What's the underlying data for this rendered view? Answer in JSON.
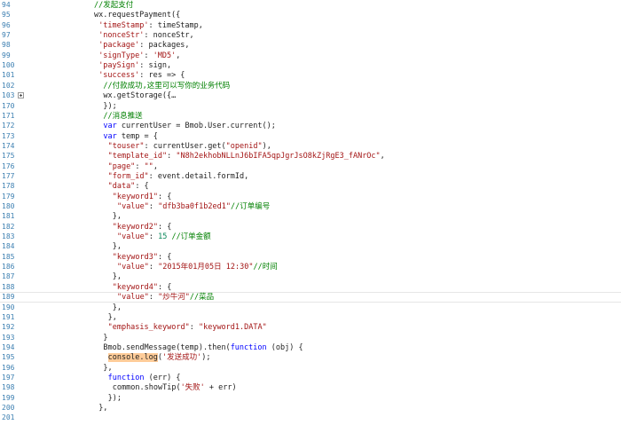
{
  "editor": {
    "lines": [
      {
        "n": "94",
        "indent": 10,
        "tokens": [
          {
            "t": "//发起支付",
            "c": "cm"
          }
        ]
      },
      {
        "n": "95",
        "indent": 10,
        "tokens": [
          {
            "t": "wx.requestPayment({",
            "c": "pl"
          }
        ]
      },
      {
        "n": "96",
        "indent": 12,
        "tokens": [
          {
            "t": "'timeStamp'",
            "c": "str"
          },
          {
            "t": ": timeStamp,",
            "c": "pl"
          }
        ]
      },
      {
        "n": "97",
        "indent": 12,
        "tokens": [
          {
            "t": "'nonceStr'",
            "c": "str"
          },
          {
            "t": ": nonceStr,",
            "c": "pl"
          }
        ]
      },
      {
        "n": "98",
        "indent": 12,
        "tokens": [
          {
            "t": "'package'",
            "c": "str"
          },
          {
            "t": ": packages,",
            "c": "pl"
          }
        ]
      },
      {
        "n": "99",
        "indent": 12,
        "tokens": [
          {
            "t": "'signType'",
            "c": "str"
          },
          {
            "t": ": ",
            "c": "pl"
          },
          {
            "t": "'MD5'",
            "c": "str"
          },
          {
            "t": ",",
            "c": "pl"
          }
        ]
      },
      {
        "n": "100",
        "indent": 12,
        "tokens": [
          {
            "t": "'paySign'",
            "c": "str"
          },
          {
            "t": ": sign,",
            "c": "pl"
          }
        ]
      },
      {
        "n": "101",
        "indent": 12,
        "tokens": [
          {
            "t": "'success'",
            "c": "str"
          },
          {
            "t": ": res => {",
            "c": "pl"
          }
        ]
      },
      {
        "n": "102",
        "indent": 14,
        "tokens": [
          {
            "t": "//付款成功,这里可以写你的业务代码",
            "c": "cm"
          }
        ]
      },
      {
        "n": "103",
        "indent": 14,
        "fold": true,
        "tokens": [
          {
            "t": "wx.getStorage({…",
            "c": "pl"
          }
        ]
      },
      {
        "n": "170",
        "indent": 14,
        "tokens": [
          {
            "t": "});",
            "c": "pl"
          }
        ]
      },
      {
        "n": "171",
        "indent": 14,
        "tokens": [
          {
            "t": "//消息推送",
            "c": "cm"
          }
        ]
      },
      {
        "n": "172",
        "indent": 14,
        "tokens": [
          {
            "t": "var",
            "c": "kw"
          },
          {
            "t": " currentUser = Bmob.User.current();",
            "c": "pl"
          }
        ]
      },
      {
        "n": "173",
        "indent": 14,
        "tokens": [
          {
            "t": "var",
            "c": "kw"
          },
          {
            "t": " temp = {",
            "c": "pl"
          }
        ]
      },
      {
        "n": "174",
        "indent": 16,
        "tokens": [
          {
            "t": "\"touser\"",
            "c": "str"
          },
          {
            "t": ": currentUser.get(",
            "c": "pl"
          },
          {
            "t": "\"openid\"",
            "c": "str"
          },
          {
            "t": "),",
            "c": "pl"
          }
        ]
      },
      {
        "n": "175",
        "indent": 16,
        "tokens": [
          {
            "t": "\"template_id\"",
            "c": "str"
          },
          {
            "t": ": ",
            "c": "pl"
          },
          {
            "t": "\"N8h2ekhobNLLnJ6bIFA5qpJgrJsO8kZjRgE3_fANrOc\"",
            "c": "str"
          },
          {
            "t": ",",
            "c": "pl"
          }
        ]
      },
      {
        "n": "176",
        "indent": 16,
        "tokens": [
          {
            "t": "\"page\"",
            "c": "str"
          },
          {
            "t": ": ",
            "c": "pl"
          },
          {
            "t": "\"\"",
            "c": "str"
          },
          {
            "t": ",",
            "c": "pl"
          }
        ]
      },
      {
        "n": "177",
        "indent": 16,
        "tokens": [
          {
            "t": "\"form_id\"",
            "c": "str"
          },
          {
            "t": ": event.detail.formId,",
            "c": "pl"
          }
        ]
      },
      {
        "n": "178",
        "indent": 16,
        "tokens": [
          {
            "t": "\"data\"",
            "c": "str"
          },
          {
            "t": ": {",
            "c": "pl"
          }
        ]
      },
      {
        "n": "179",
        "indent": 18,
        "tokens": [
          {
            "t": "\"keyword1\"",
            "c": "str"
          },
          {
            "t": ": {",
            "c": "pl"
          }
        ]
      },
      {
        "n": "180",
        "indent": 20,
        "tokens": [
          {
            "t": "\"value\"",
            "c": "str"
          },
          {
            "t": ": ",
            "c": "pl"
          },
          {
            "t": "\"dfb3ba0f1b2ed1\"",
            "c": "str"
          },
          {
            "t": "//订单编号",
            "c": "cm"
          }
        ]
      },
      {
        "n": "181",
        "indent": 18,
        "tokens": [
          {
            "t": "},",
            "c": "pl"
          }
        ]
      },
      {
        "n": "182",
        "indent": 18,
        "tokens": [
          {
            "t": "\"keyword2\"",
            "c": "str"
          },
          {
            "t": ": {",
            "c": "pl"
          }
        ]
      },
      {
        "n": "183",
        "indent": 20,
        "tokens": [
          {
            "t": "\"value\"",
            "c": "str"
          },
          {
            "t": ": ",
            "c": "pl"
          },
          {
            "t": "15",
            "c": "num"
          },
          {
            "t": " //订单金额",
            "c": "cm"
          }
        ]
      },
      {
        "n": "184",
        "indent": 18,
        "tokens": [
          {
            "t": "},",
            "c": "pl"
          }
        ]
      },
      {
        "n": "185",
        "indent": 18,
        "tokens": [
          {
            "t": "\"keyword3\"",
            "c": "str"
          },
          {
            "t": ": {",
            "c": "pl"
          }
        ]
      },
      {
        "n": "186",
        "indent": 20,
        "tokens": [
          {
            "t": "\"value\"",
            "c": "str"
          },
          {
            "t": ": ",
            "c": "pl"
          },
          {
            "t": "\"2015年01月05日 12:30\"",
            "c": "str"
          },
          {
            "t": "//时间",
            "c": "cm"
          }
        ]
      },
      {
        "n": "187",
        "indent": 18,
        "tokens": [
          {
            "t": "},",
            "c": "pl"
          }
        ]
      },
      {
        "n": "188",
        "indent": 18,
        "tokens": [
          {
            "t": "\"keyword4\"",
            "c": "str"
          },
          {
            "t": ": {",
            "c": "pl"
          }
        ]
      },
      {
        "n": "189",
        "indent": 20,
        "current": true,
        "tokens": [
          {
            "t": "\"value\"",
            "c": "str"
          },
          {
            "t": ": ",
            "c": "pl"
          },
          {
            "t": "\"炒牛河\"",
            "c": "str"
          },
          {
            "t": "//菜品",
            "c": "cm"
          }
        ]
      },
      {
        "n": "190",
        "indent": 18,
        "tokens": [
          {
            "t": "},",
            "c": "pl"
          }
        ]
      },
      {
        "n": "191",
        "indent": 16,
        "tokens": [
          {
            "t": "},",
            "c": "pl"
          }
        ]
      },
      {
        "n": "192",
        "indent": 16,
        "tokens": [
          {
            "t": "\"emphasis_keyword\"",
            "c": "str"
          },
          {
            "t": ": ",
            "c": "pl"
          },
          {
            "t": "\"keyword1.DATA\"",
            "c": "str"
          }
        ]
      },
      {
        "n": "193",
        "indent": 14,
        "tokens": [
          {
            "t": "}",
            "c": "pl"
          }
        ]
      },
      {
        "n": "194",
        "indent": 14,
        "tokens": [
          {
            "t": "Bmob.sendMessage(temp).then(",
            "c": "pl"
          },
          {
            "t": "function",
            "c": "kw"
          },
          {
            "t": " (obj) {",
            "c": "pl"
          }
        ]
      },
      {
        "n": "195",
        "indent": 16,
        "tokens": [
          {
            "t": "console.log",
            "c": "hl"
          },
          {
            "t": "(",
            "c": "pl"
          },
          {
            "t": "'发送成功'",
            "c": "str"
          },
          {
            "t": ");",
            "c": "pl"
          }
        ]
      },
      {
        "n": "196",
        "indent": 14,
        "tokens": [
          {
            "t": "},",
            "c": "pl"
          }
        ]
      },
      {
        "n": "197",
        "indent": 16,
        "tokens": [
          {
            "t": "function",
            "c": "kw"
          },
          {
            "t": " (err) {",
            "c": "pl"
          }
        ]
      },
      {
        "n": "198",
        "indent": 18,
        "tokens": [
          {
            "t": "common.showTip(",
            "c": "pl"
          },
          {
            "t": "'失败'",
            "c": "str"
          },
          {
            "t": " + err)",
            "c": "pl"
          }
        ]
      },
      {
        "n": "199",
        "indent": 16,
        "tokens": [
          {
            "t": "});",
            "c": "pl"
          }
        ]
      },
      {
        "n": "200",
        "indent": 12,
        "tokens": [
          {
            "t": "},",
            "c": "pl"
          }
        ]
      },
      {
        "n": "201",
        "indent": 12,
        "tokens": [
          {
            "t": "",
            "c": "pl"
          }
        ]
      }
    ]
  }
}
